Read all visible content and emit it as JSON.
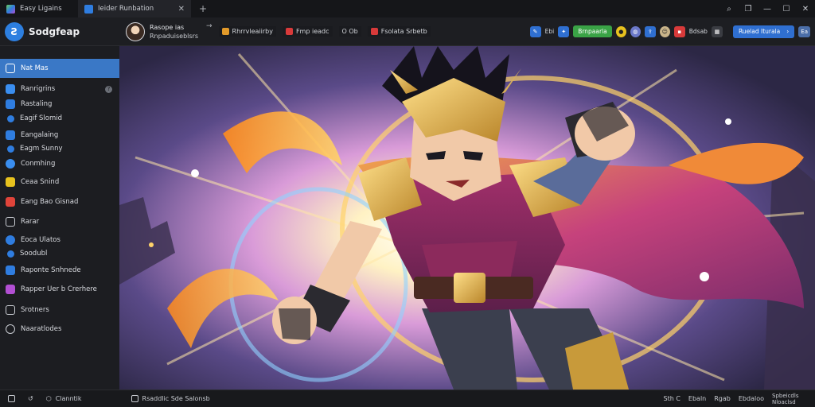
{
  "tabs": [
    {
      "label": "Easy Ligains",
      "icon": "app-icon"
    },
    {
      "label": "Ieider Runbation",
      "icon": "doc-icon",
      "close": "✕"
    }
  ],
  "new_tab": "+",
  "window_controls": {
    "search": "⌕",
    "restore": "❐",
    "minimize": "—",
    "maximize": "☐",
    "close": "✕"
  },
  "brand": {
    "logo": "Ƨ",
    "name": "Sodgfeap"
  },
  "profile": {
    "name": "Rasope ias",
    "sub": "Rnpaduiseblsrs",
    "arrow": "→"
  },
  "header_chips": [
    {
      "label": "Rhrrvleaiirby",
      "color": "#e29a2a"
    },
    {
      "label": "Fmp ieadc",
      "color": "#d83a3a"
    },
    {
      "label": "O Ob",
      "color": "#8a8f98"
    },
    {
      "label": "Fsolata Srbetb",
      "color": "#d83a3a"
    }
  ],
  "header_right": {
    "group_a": [
      "Ebi",
      "Eb"
    ],
    "green_button": "Brnpaarla",
    "icons_label": "Bdsab",
    "blue_button": "Ruelad Iturala",
    "blue_arrow": "›",
    "end_label": "Ea"
  },
  "sidebar": {
    "items": [
      {
        "label": "Nat Mas",
        "icon": "home-icon",
        "color": "#ffffff",
        "active": true
      },
      {
        "label": "Ranrigrins",
        "icon": "bookmark-icon",
        "color": "#3a8ef0",
        "badge": "?"
      },
      {
        "label": "Rastaling",
        "icon": "brush-icon",
        "color": "#2f7de0"
      },
      {
        "label": "Eagif Slomid",
        "icon": "palette-icon",
        "color": "#2f7de0",
        "small": true
      },
      {
        "label": "Eangalaing",
        "icon": "layers-icon",
        "color": "#2f7de0"
      },
      {
        "label": "Eagm Sunny",
        "icon": "dot-icon",
        "color": "#2f7de0",
        "small": true
      },
      {
        "label": "Conmhing",
        "icon": "globe-icon",
        "color": "#3a8ef0"
      },
      {
        "label": "Ceaa Snind",
        "icon": "folder-icon",
        "color": "#e8c21e"
      },
      {
        "label": "Eang Bao Gisnad",
        "icon": "grid-icon",
        "color": "#e0443a"
      },
      {
        "label": "Rarar",
        "icon": "square-icon",
        "color": "#8a8f98"
      },
      {
        "label": "Eoca Ulatos",
        "icon": "user-icon",
        "color": "#2f7de0"
      },
      {
        "label": "Soodubl",
        "icon": "dot-icon",
        "color": "#2f7de0",
        "small": true
      },
      {
        "label": "Raponte Snhnede",
        "icon": "settings-icon",
        "color": "#2f7de0"
      },
      {
        "label": "Rapper Uer b Crerhere",
        "icon": "pen-icon",
        "color": "#b24fd3"
      },
      {
        "label": "Srotners",
        "icon": "list-icon",
        "color": "#8a8f98"
      },
      {
        "label": "Naaratlodes",
        "icon": "check-icon",
        "color": "#8a8f98"
      }
    ]
  },
  "statusbar": {
    "left": [
      {
        "label": "",
        "icon": "panel-icon"
      },
      {
        "label": "",
        "icon": "undo-icon"
      },
      {
        "label": "Clanntik",
        "icon": "shape-icon"
      },
      {
        "label": "Rsaddlic Sde Salonsb",
        "icon": "layout-icon"
      }
    ],
    "right": [
      "Sth C",
      "Ebaln",
      "Rgab",
      "Ebdaloo",
      "Spbeicdls Nloaclsd"
    ]
  }
}
